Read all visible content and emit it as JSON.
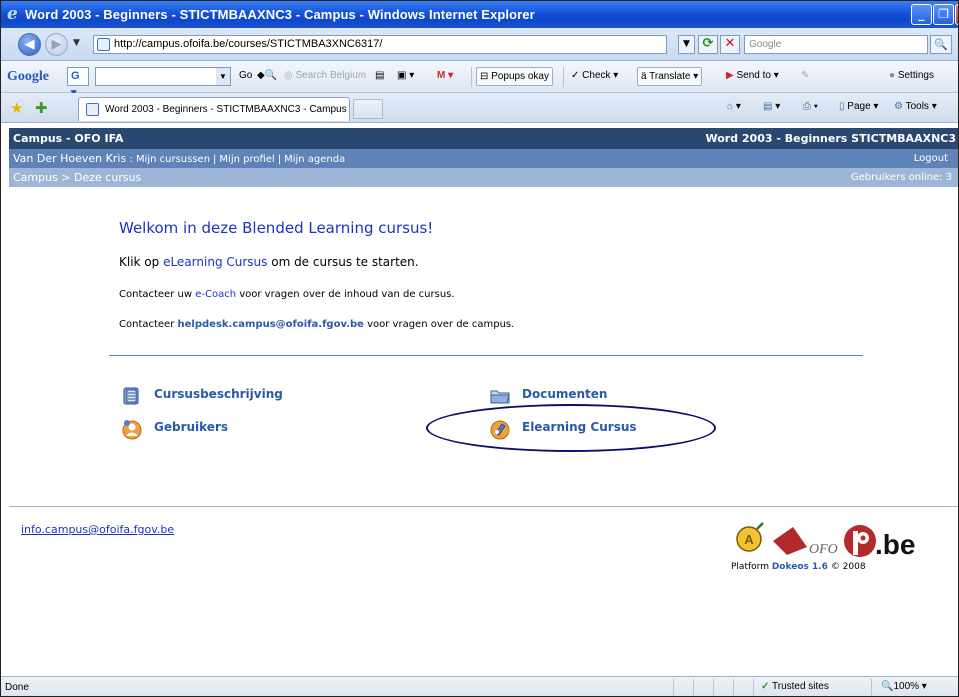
{
  "window": {
    "title": "Word 2003 - Beginners - STICTMBAAXNC3 - Campus - Windows Internet Explorer",
    "controls": {
      "minimize": "_",
      "maximize": "❐",
      "close": "x"
    }
  },
  "address_bar": {
    "url": "http://campus.ofoifa.be/courses/STICTMBA3XNC6317/",
    "search_placeholder": "Google"
  },
  "google_toolbar": {
    "logo": "Google",
    "engine": "G",
    "go": "Go",
    "search_site": "Search Belgium",
    "popups": "Popups okay",
    "check": "Check",
    "translate": "Translate",
    "send_to": "Send to",
    "settings": "Settings"
  },
  "tabs": [
    {
      "label": "Word 2003 - Beginners - STICTMBAAXNC3 - Campus"
    }
  ],
  "command_bar": {
    "page": "Page",
    "tools": "Tools"
  },
  "campus": {
    "header_left": "Campus - OFO IFA",
    "header_right": "Word 2003 - Beginners STICTMBAAXNC3",
    "user": "Van Der Hoeven Kris",
    "nav": [
      "Mijn cursussen",
      "Mijn profiel",
      "Mijn agenda"
    ],
    "logout": "Logout",
    "breadcrumb": "Campus > Deze cursus",
    "online": "Gebruikers online: 3",
    "welcome": "Welkom in deze Blended Learning cursus!",
    "line1_pre": "Klik op ",
    "line1_link": "eLearning Cursus",
    "line1_post": " om de cursus te starten.",
    "line2_pre": "Contacteer uw ",
    "line2_link": "e-Coach",
    "line2_post": " voor vragen over de inhoud van de cursus.",
    "line3_pre": "Contacteer ",
    "line3_link": "helpdesk.campus@ofoifa.fgov.be",
    "line3_post": " voor vragen over de campus.",
    "shortcuts": {
      "course_description": "Cursusbeschrijving",
      "users": "Gebruikers",
      "documents": "Documenten",
      "elearning": "Elearning Cursus"
    },
    "footer_email": "info.campus@ofoifa.fgov.be",
    "platform_prefix": "Platform ",
    "platform_name": "Dokeos 1.6",
    "platform_suffix": " © 2008",
    "logo_text_ofo": "OFO",
    "logo_text_be": ".be"
  },
  "status_bar": {
    "status": "Done",
    "zone": "Trusted sites",
    "zoom": "100%"
  },
  "colors": {
    "header_dark": "#2a4870",
    "header_mid": "#5f83b6",
    "header_light": "#9db6d8",
    "link": "#1a32c8",
    "annotation_ellipse": "#0b0f6a"
  }
}
